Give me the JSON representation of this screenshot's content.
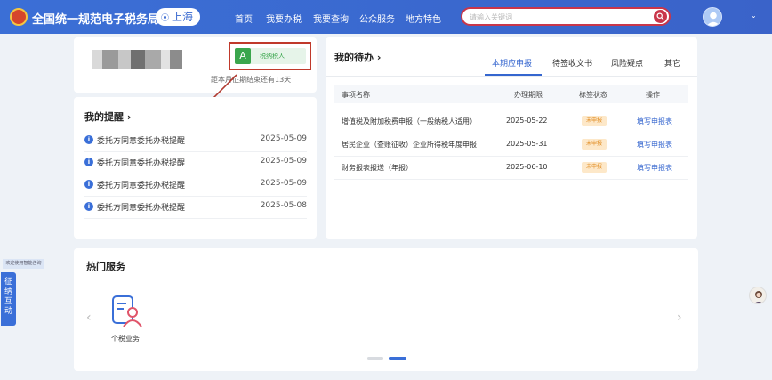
{
  "header": {
    "site_title": "全国统一规范电子税务局",
    "city": "上海",
    "nav": [
      "首页",
      "我要办税",
      "我要查询",
      "公众服务",
      "地方特色"
    ],
    "search_placeholder": "请输入关键词"
  },
  "user_card": {
    "taxpayer_letter": "A",
    "taxpayer_label": "税纳税人",
    "deadline_text": "距本月征期结束还有13天"
  },
  "reminders": {
    "title": "我的提醒 ›",
    "items": [
      {
        "text": "委托方同意委托办税提醒",
        "date": "2025-05-09"
      },
      {
        "text": "委托方同意委托办税提醒",
        "date": "2025-05-09"
      },
      {
        "text": "委托方同意委托办税提醒",
        "date": "2025-05-09"
      },
      {
        "text": "委托方同意委托办税提醒",
        "date": "2025-05-08"
      }
    ]
  },
  "todos": {
    "title": "我的待办 ›",
    "tabs": [
      "本期应申报",
      "待签收文书",
      "风险疑点",
      "其它"
    ],
    "columns": [
      "事项名称",
      "办理期限",
      "标签状态",
      "操作"
    ],
    "rows": [
      {
        "name": "增值税及附加税费申报（一般纳税人适用）",
        "deadline": "2025-05-22",
        "status": "未申报",
        "action": "填写申报表"
      },
      {
        "name": "居民企业（查账征收）企业所得税年度申报",
        "deadline": "2025-05-31",
        "status": "未申报",
        "action": "填写申报表"
      },
      {
        "name": "财务报表报送（年报）",
        "deadline": "2025-06-10",
        "status": "未申报",
        "action": "填写申报表"
      }
    ]
  },
  "services": {
    "title": "热门服务",
    "items": [
      {
        "label": "个税业务",
        "icon": "personal-tax-icon"
      }
    ]
  },
  "side": {
    "tip": "欢迎使用智能咨询",
    "interaction_tab": "征纳互动"
  },
  "colors": {
    "header_blue": "#3b6fd6",
    "accent_red": "#c9364a",
    "taxpayer_green": "#3aa64d",
    "link_blue": "#3566cf",
    "status_orange": "#e08a1e"
  }
}
